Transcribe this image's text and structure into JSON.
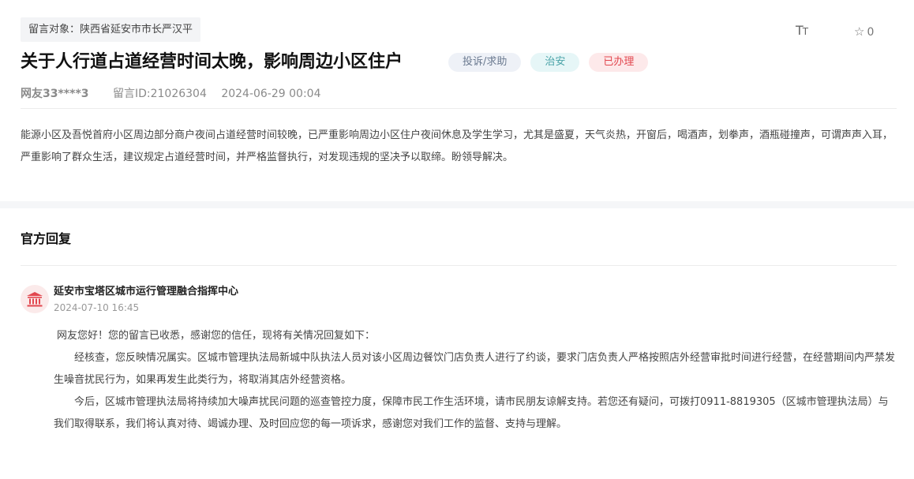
{
  "message": {
    "target_label": "留言对象：陕西省延安市市长严汉平",
    "title": "关于人行道占道经营时间太晚，影响周边小区住户",
    "tags": {
      "type": "投诉/求助",
      "field": "治安",
      "status": "已办理"
    },
    "author": "网友33****3",
    "message_id": "留言ID:21026304",
    "date": "2024-06-29 00:04",
    "content": "能源小区及吾悦首府小区周边部分商户夜间占道经营时间较晚，已严重影响周边小区住户夜间休息及学生学习，尤其是盛夏，天气炎热，开窗后，喝酒声，划拳声，酒瓶碰撞声，可谓声声入耳，严重影响了群众生活，建议规定占道经营时间，并严格监督执行，对发现违规的坚决予以取缔。盼领导解决。"
  },
  "toolbar": {
    "font_size_glyph_big": "T",
    "font_size_glyph_small": "T",
    "star_glyph": "☆",
    "favorite_count": "0"
  },
  "reply": {
    "section_title": "官方回复",
    "org_name": "延安市宝塔区城市运行管理融合指挥中心",
    "time": "2024-07-10 16:45",
    "paragraphs": [
      "网友您好！您的留言已收悉，感谢您的信任，现将有关情况回复如下：",
      "经核查，您反映情况属实。区城市管理执法局新城中队执法人员对该小区周边餐饮门店负责人进行了约谈，要求门店负责人严格按照店外经营审批时间进行经营，在经营期间内严禁发生噪音扰民行为，如果再发生此类行为，将取消其店外经营资格。",
      "今后，区城市管理执法局将持续加大噪声扰民问题的巡查管控力度，保障市民工作生活环境，请市民朋友谅解支持。若您还有疑问，可拨打0911-8819305（区城市管理执法局）与我们取得联系，我们将认真对待、竭诚办理、及时回应您的每一项诉求，感谢您对我们工作的监督、支持与理解。"
    ]
  },
  "colors": {
    "tag_type_bg": "#eef1f7",
    "tag_field_bg": "#e6f6f7",
    "tag_status_bg": "#fde9ea",
    "tag_status_text": "#e2474f",
    "org_icon": "#e2474f"
  },
  "icons": {
    "font_size": "font-size-icon",
    "favorite": "star-outline-icon",
    "org": "government-building-icon"
  }
}
